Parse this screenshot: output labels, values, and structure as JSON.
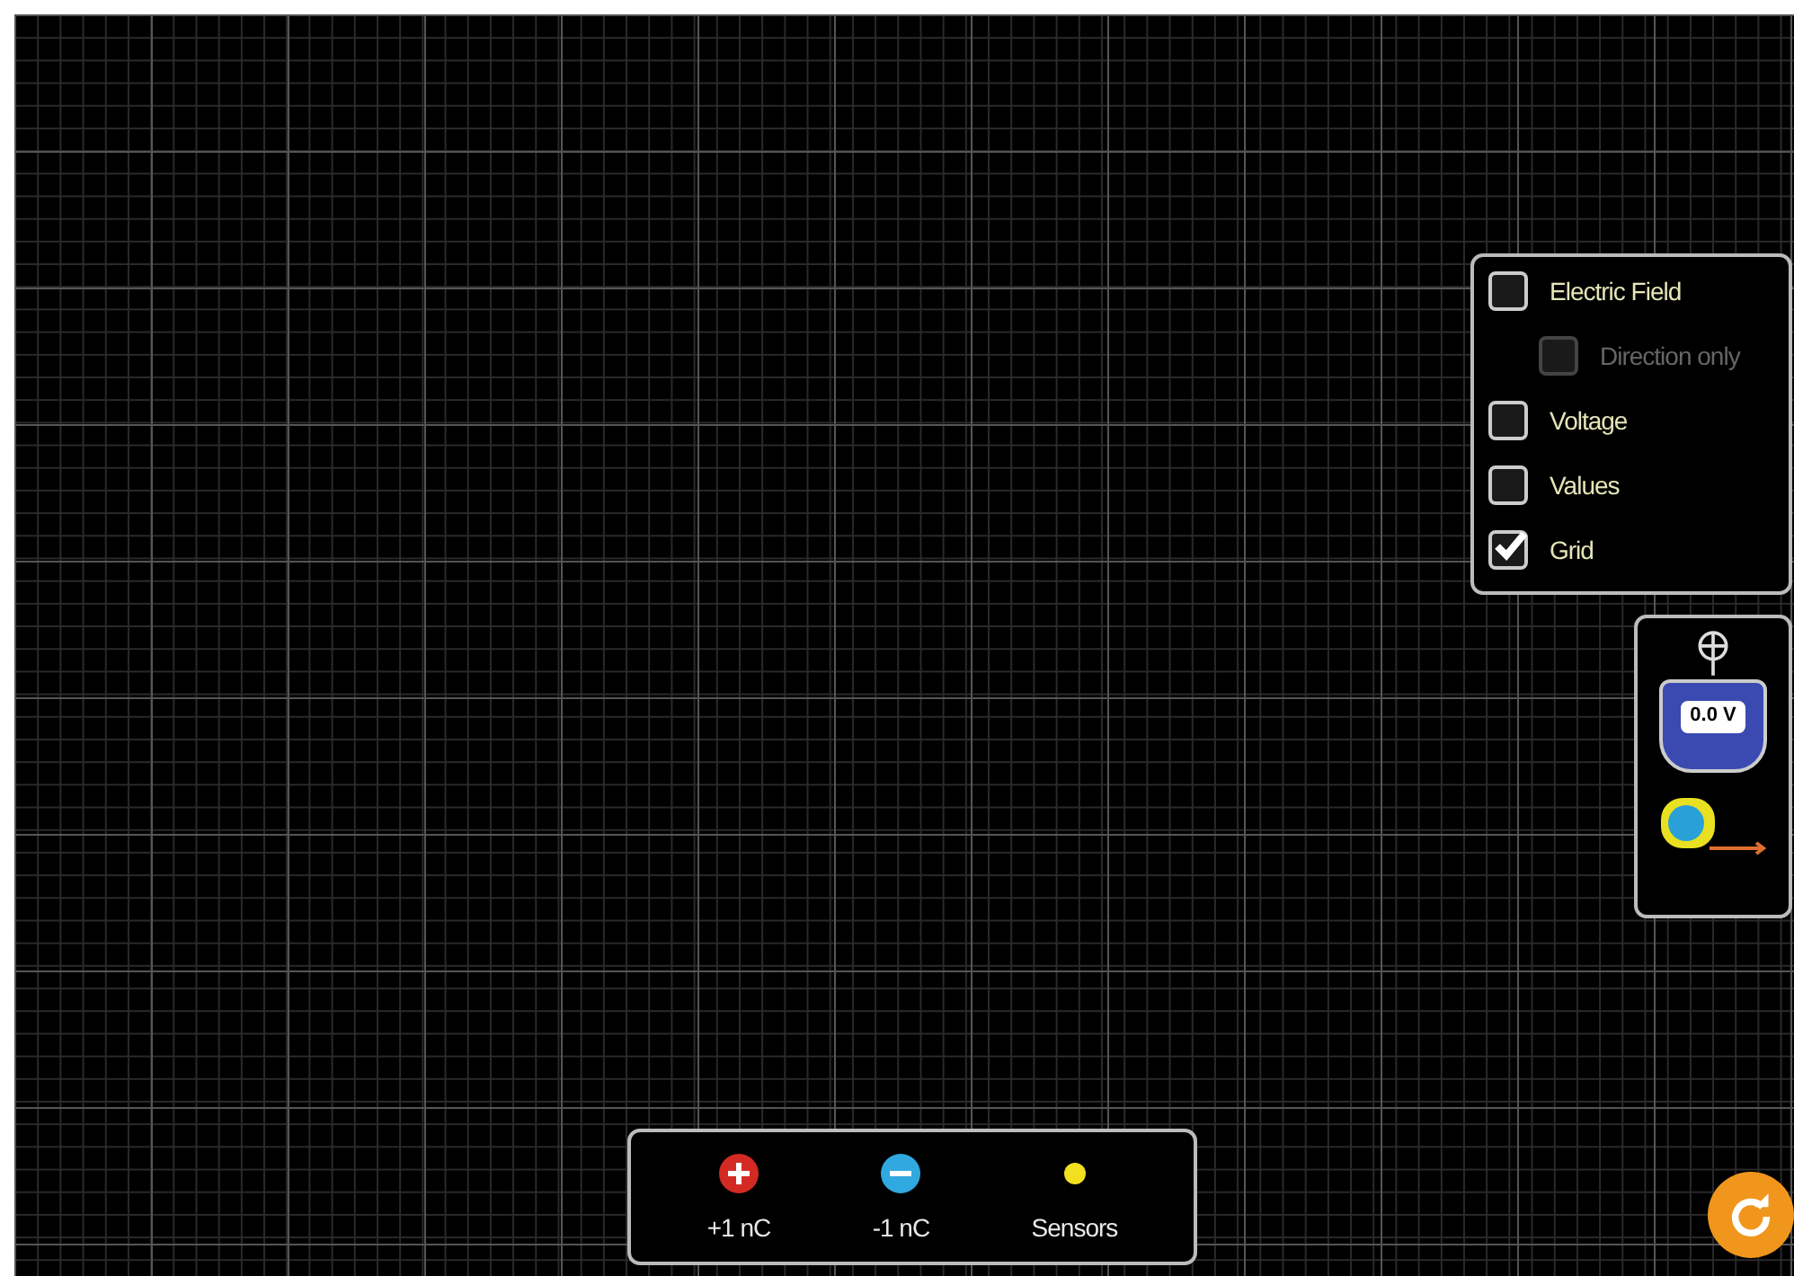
{
  "options": [
    {
      "label": "Electric Field",
      "checked": false,
      "children": [
        {
          "label": "Direction only",
          "checked": false,
          "disabled": true
        }
      ]
    },
    {
      "label": "Voltage",
      "checked": false
    },
    {
      "label": "Values",
      "checked": false
    },
    {
      "label": "Grid",
      "checked": true
    }
  ],
  "voltmeter": {
    "reading": "0.0 V"
  },
  "charges": [
    {
      "kind": "positive",
      "label": "+1 nC"
    },
    {
      "kind": "negative",
      "label": "-1 nC"
    },
    {
      "kind": "sensor",
      "label": "Sensors"
    }
  ]
}
